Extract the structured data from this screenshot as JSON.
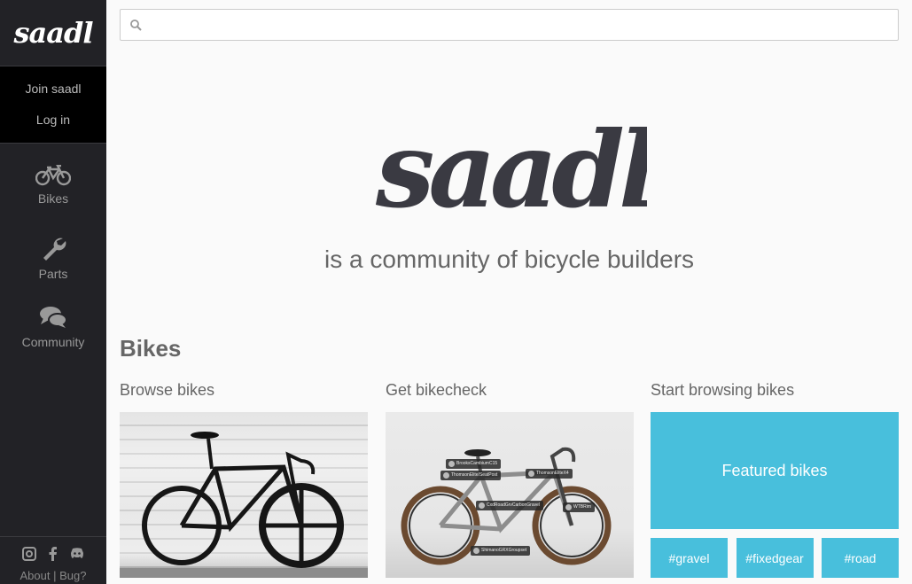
{
  "brand": {
    "name": "saadl"
  },
  "auth": {
    "join": "Join saadl",
    "login": "Log in"
  },
  "nav": [
    {
      "label": "Bikes",
      "icon": "bicycle-icon"
    },
    {
      "label": "Parts",
      "icon": "wrench-icon"
    },
    {
      "label": "Community",
      "icon": "comments-icon"
    }
  ],
  "footer": {
    "about": "About",
    "separator": "|",
    "bug": "Bug?",
    "social": [
      "instagram-icon",
      "facebook-icon",
      "discord-icon"
    ]
  },
  "search": {
    "placeholder": "",
    "value": ""
  },
  "hero": {
    "logo_text": "saadl",
    "tagline": "is a community of bicycle builders"
  },
  "section": {
    "title": "Bikes",
    "columns": [
      {
        "heading": "Browse bikes"
      },
      {
        "heading": "Get bikecheck",
        "tags": [
          "BrooksCambiumC15",
          "ThomsonElite/SeatPost",
          "ThomsonEliteX4",
          "CxdRoadGrvCarbonGravel",
          "WTBRim",
          "ShimanoGRXGroupset"
        ]
      },
      {
        "heading": "Start browsing bikes",
        "featured": "Featured bikes",
        "hashtags": [
          "#gravel",
          "#fixedgear",
          "#road"
        ]
      }
    ]
  },
  "colors": {
    "sidebar": "#222226",
    "accent": "#48bfdc",
    "logo_dark": "#3a3a42"
  }
}
